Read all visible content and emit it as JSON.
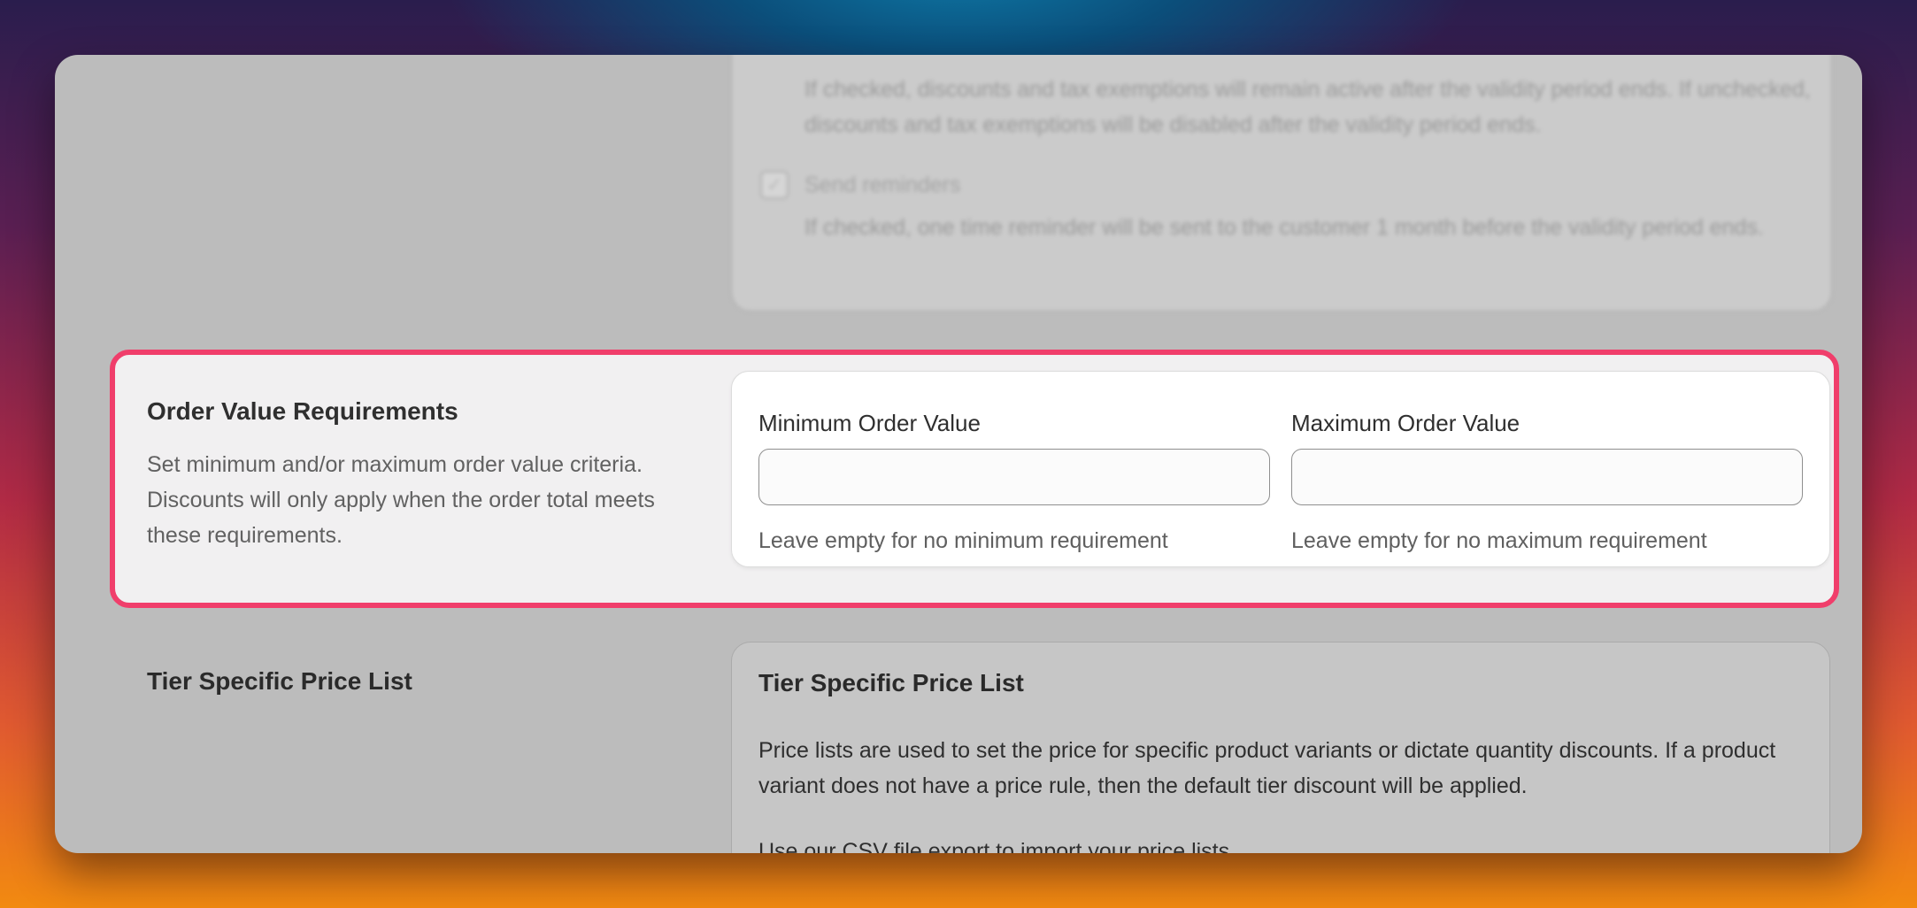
{
  "settings_above": {
    "description": "If checked, discounts and tax exemptions will remain active after the validity period ends. If unchecked, discounts and tax exemptions will be disabled after the validity period ends.",
    "send_reminders_label": "Send reminders",
    "send_reminders_checked": true,
    "send_reminders_description": "If checked, one time reminder will be sent to the customer 1 month before the validity period ends."
  },
  "order_value": {
    "title": "Order Value Requirements",
    "description": "Set minimum and/or maximum order value criteria. Discounts will only apply when the order total meets these requirements.",
    "min_label": "Minimum Order Value",
    "min_value": "",
    "min_help": "Leave empty for no minimum requirement",
    "max_label": "Maximum Order Value",
    "max_value": "",
    "max_help": "Leave empty for no maximum requirement",
    "highlight_color": "#f03e6b"
  },
  "tier_price_list": {
    "section_title": "Tier Specific Price List",
    "card_title": "Tier Specific Price List",
    "description": "Price lists are used to set the price for specific product variants or dictate quantity discounts. If a product variant does not have a price rule, then the default tier discount will be applied.",
    "csv_text": "Use our CSV file export to import your price lists."
  }
}
